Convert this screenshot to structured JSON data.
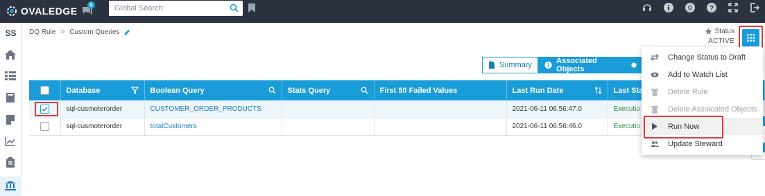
{
  "topbar": {
    "logo": "OVALEDGE",
    "chat_badge": "0",
    "search_placeholder": "Global Search",
    "icons": [
      "headset-icon",
      "info-icon",
      "chrome-icon",
      "help-icon",
      "expand-icon",
      "logout-icon"
    ]
  },
  "sidebar": {
    "top_label": "SS",
    "items": [
      "home-icon",
      "table-list-icon",
      "book-icon",
      "note-icon",
      "chart-icon",
      "clipboard-icon",
      "bank-icon"
    ]
  },
  "breadcrumb": {
    "root": "DQ Rule",
    "separator": ">",
    "current": "Custom Queries"
  },
  "status": {
    "label": "Status",
    "value": "ACTIVE"
  },
  "tabs": {
    "summary": "Summary",
    "associated": "Associated Objects"
  },
  "table": {
    "headers": {
      "database": "Database",
      "boolean_query": "Boolean Query",
      "stats_query": "Stats Query",
      "first_50": "First 50 Failed Values",
      "last_run_date": "Last Run Date",
      "last_status": "Last Sta"
    },
    "rows": [
      {
        "database": "sql-cusmoterorder",
        "boolean_query": "CUSTOMER_ORDER_PRODUCTS",
        "stats_query": "",
        "first_50": "",
        "last_run_date": "2021-06-11 06:56:47.0",
        "last_status": "Executio",
        "checked": true
      },
      {
        "database": "sql-cusmoterorder",
        "boolean_query": "totalCustomers",
        "stats_query": "",
        "first_50": "",
        "last_run_date": "2021-06-11 06:56:46.0",
        "last_status": "Executio",
        "checked": false
      }
    ]
  },
  "menu": {
    "items": [
      {
        "label": "Change Status to Draft",
        "icon": "swap-icon",
        "disabled": false
      },
      {
        "label": "Add to Watch List",
        "icon": "eye-icon",
        "disabled": false
      },
      {
        "label": "Delete Rule",
        "icon": "trash-icon",
        "disabled": true
      },
      {
        "label": "Delete Assoicated Objects",
        "icon": "trash-icon",
        "disabled": true
      },
      {
        "label": "Run Now",
        "icon": "play-icon",
        "disabled": false
      },
      {
        "label": "Update Steward",
        "icon": "users-icon",
        "disabled": false
      }
    ]
  },
  "colors": {
    "accent": "#1a9cd8",
    "topbar": "#2b3340",
    "highlight": "#e53935",
    "executed": "#2e8b3e"
  }
}
